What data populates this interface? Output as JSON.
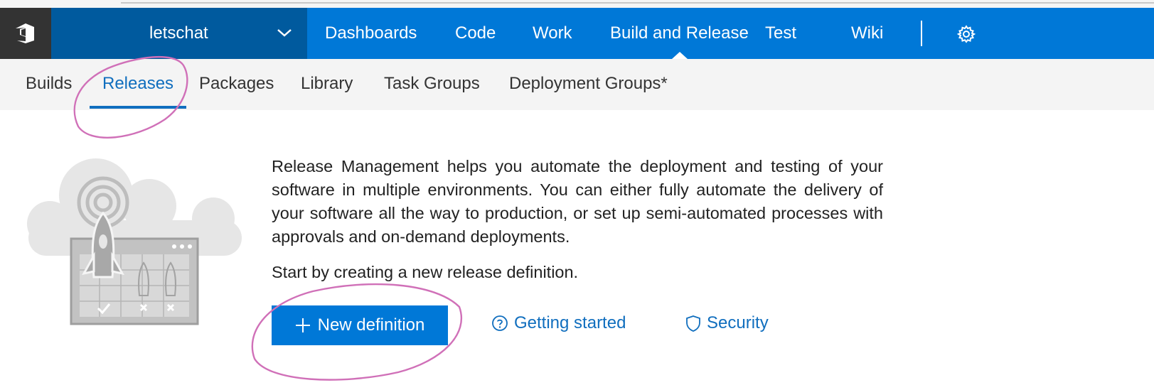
{
  "project": {
    "name": "letschat"
  },
  "nav": {
    "items": [
      "Dashboards",
      "Code",
      "Work",
      "Build and Release",
      "Test",
      "Wiki"
    ],
    "active": "Build and Release"
  },
  "subnav": {
    "items": [
      "Builds",
      "Releases",
      "Packages",
      "Library",
      "Task Groups",
      "Deployment Groups*"
    ],
    "active": "Releases"
  },
  "main": {
    "description": "Release Management helps you automate the deployment and testing of your software in multiple environments. You can either fully automate the delivery of your software all the way to production, or set up semi-automated processes with approvals and on-demand deployments.",
    "start_text": "Start by creating a new release definition.",
    "new_definition_label": "New definition",
    "getting_started_label": "Getting started",
    "security_label": "Security"
  },
  "colors": {
    "nav_blue": "#0078d7",
    "project_blue": "#005a9e",
    "accent": "#106ebe",
    "annotation": "#d070b8"
  }
}
